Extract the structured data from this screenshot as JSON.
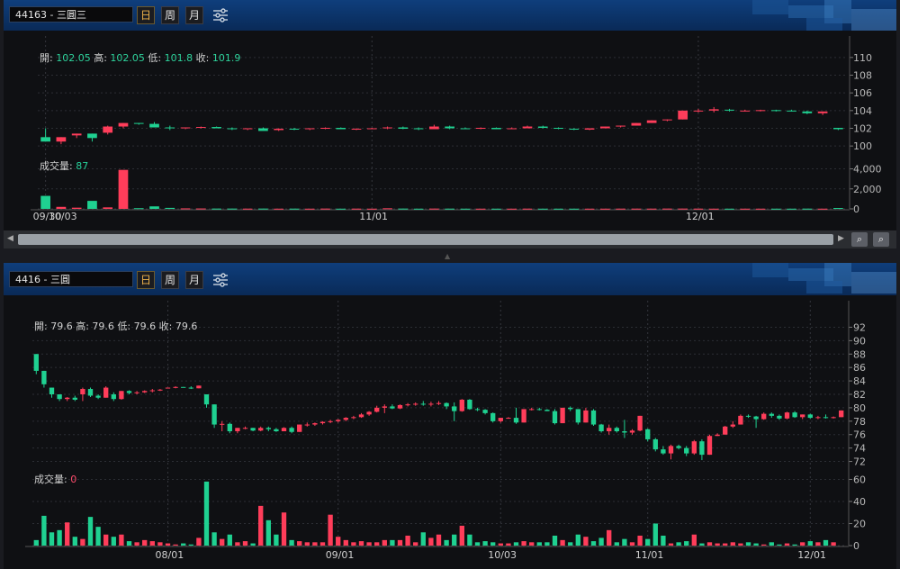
{
  "panels": [
    {
      "symbol": "44163 - 三圓三",
      "periods": [
        "日",
        "周",
        "月"
      ],
      "active_period": "日",
      "ohlc": {
        "open_label": "開:",
        "open": "102.05",
        "high_label": "高:",
        "high": "102.05",
        "low_label": "低:",
        "low": "101.8",
        "close_label": "收:",
        "close": "101.9"
      },
      "volume": {
        "label": "成交量:",
        "value": "87",
        "color": "#26d09a"
      },
      "price_axis": {
        "min": 99,
        "max": 111,
        "ticks": [
          "110",
          "108",
          "106",
          "104",
          "102",
          "100"
        ]
      },
      "volume_axis": {
        "max": 4500,
        "ticks": [
          "4,000",
          "2,000",
          "0"
        ]
      },
      "date_labels": [
        {
          "label": "09/30",
          "i": 0
        },
        {
          "label": "10/03",
          "i": 1
        },
        {
          "label": "11/01",
          "i": 21
        },
        {
          "label": "12/01",
          "i": 42
        }
      ],
      "gridlines_i": [
        0,
        21,
        42
      ],
      "bars": [
        [
          101,
          102,
          100.5,
          100.5,
          1300
        ],
        [
          100.5,
          101,
          100.2,
          101,
          200
        ],
        [
          101.2,
          101.4,
          100.9,
          101.4,
          120
        ],
        [
          101.4,
          101.4,
          100.5,
          100.9,
          800
        ],
        [
          101.5,
          102.3,
          101.3,
          102.2,
          150
        ],
        [
          102.2,
          102.6,
          102,
          102.6,
          3900
        ],
        [
          102.6,
          102.6,
          102.4,
          102.5,
          70
        ],
        [
          102.5,
          102.7,
          102.1,
          102.1,
          250
        ],
        [
          102.1,
          102.3,
          101.8,
          102,
          100
        ],
        [
          102,
          102.1,
          101.9,
          102.1,
          50
        ],
        [
          102.1,
          102.2,
          102,
          102.15,
          40
        ],
        [
          102.15,
          102.2,
          102,
          102,
          30
        ],
        [
          102,
          102.1,
          101.8,
          101.9,
          30
        ],
        [
          101.9,
          102,
          101.8,
          102,
          25
        ],
        [
          102,
          102.1,
          101.8,
          101.7,
          30
        ],
        [
          101.8,
          102,
          101.7,
          101.95,
          20
        ],
        [
          101.95,
          102.05,
          101.8,
          101.85,
          25
        ],
        [
          101.9,
          102,
          101.8,
          102,
          20
        ],
        [
          102,
          102.1,
          101.9,
          102.05,
          30
        ],
        [
          102.05,
          102.1,
          101.9,
          101.9,
          20
        ],
        [
          101.9,
          102,
          101.8,
          101.95,
          25
        ],
        [
          101.95,
          102.05,
          101.9,
          102,
          20
        ],
        [
          102,
          102.2,
          101.9,
          102.1,
          60
        ],
        [
          102.1,
          102.2,
          101.9,
          101.95,
          30
        ],
        [
          102,
          102.1,
          101.8,
          101.9,
          20
        ],
        [
          101.9,
          102.4,
          101.9,
          102.2,
          30
        ],
        [
          102.2,
          102.3,
          101.9,
          102,
          25
        ],
        [
          102,
          102.1,
          101.9,
          101.95,
          20
        ],
        [
          101.95,
          102.1,
          101.9,
          102.05,
          20
        ],
        [
          102.05,
          102.1,
          101.9,
          101.9,
          20
        ],
        [
          101.9,
          102.1,
          101.9,
          102,
          20
        ],
        [
          102,
          102.3,
          102,
          102.2,
          25
        ],
        [
          102.2,
          102.3,
          102,
          102.05,
          20
        ],
        [
          102.05,
          102.1,
          101.9,
          101.95,
          20
        ],
        [
          101.95,
          102,
          101.8,
          101.85,
          20
        ],
        [
          101.85,
          102,
          101.8,
          102,
          20
        ],
        [
          102,
          102.2,
          102,
          102.2,
          20
        ],
        [
          102.2,
          102.3,
          102.1,
          102.3,
          25
        ],
        [
          102.3,
          102.6,
          102.3,
          102.6,
          25
        ],
        [
          102.6,
          102.9,
          102.6,
          102.9,
          25
        ],
        [
          102.9,
          103,
          102.8,
          103,
          30
        ],
        [
          103,
          104,
          103,
          104,
          30
        ],
        [
          104,
          104.2,
          103.8,
          104,
          25
        ],
        [
          104,
          104.4,
          103.8,
          104.15,
          20
        ],
        [
          104.1,
          104.2,
          103.9,
          104,
          20
        ],
        [
          104,
          104.1,
          103.9,
          104,
          20
        ],
        [
          104,
          104.1,
          103.9,
          104.05,
          20
        ],
        [
          104.05,
          104.1,
          103.9,
          104,
          20
        ],
        [
          104,
          104.1,
          103.9,
          103.9,
          20
        ],
        [
          103.9,
          104,
          103.6,
          103.7,
          25
        ],
        [
          103.7,
          103.9,
          103.5,
          103.9,
          20
        ],
        [
          102.05,
          102.05,
          101.8,
          101.9,
          87
        ]
      ]
    },
    {
      "symbol": "4416 - 三圓",
      "periods": [
        "日",
        "周",
        "月"
      ],
      "active_period": "日",
      "ohlc": {
        "open_label": "開:",
        "open": "79.6",
        "high_label": "高:",
        "high": "79.6",
        "low_label": "低:",
        "low": "79.6",
        "close_label": "收:",
        "close": "79.6"
      },
      "volume": {
        "label": "成交量:",
        "value": "0",
        "color": "#ff4d6d"
      },
      "price_axis": {
        "min": 71,
        "max": 93,
        "ticks": [
          "92",
          "90",
          "88",
          "86",
          "84",
          "82",
          "80",
          "78",
          "76",
          "74",
          "72"
        ]
      },
      "volume_axis": {
        "max": 62,
        "ticks": [
          "60",
          "40",
          "20",
          "0"
        ]
      },
      "date_labels": [
        {
          "label": "08/01",
          "i": 17
        },
        {
          "label": "09/01",
          "i": 39
        },
        {
          "label": "10/03",
          "i": 60
        },
        {
          "label": "11/01",
          "i": 79
        },
        {
          "label": "12/01",
          "i": 100
        }
      ],
      "gridlines_i": [
        17,
        39,
        60,
        79,
        100
      ],
      "bars": [
        [
          88,
          88,
          85,
          85.5,
          5
        ],
        [
          85.5,
          85.5,
          83,
          83.5,
          27
        ],
        [
          83,
          83,
          81.5,
          82,
          12
        ],
        [
          82,
          82,
          81,
          81.3,
          14
        ],
        [
          81.3,
          81.6,
          81,
          81.5,
          21
        ],
        [
          81.5,
          81.8,
          81,
          81.2,
          8
        ],
        [
          82,
          83,
          81,
          82.8,
          6
        ],
        [
          82.8,
          83,
          81.6,
          81.8,
          26
        ],
        [
          81.8,
          82,
          81.3,
          81.5,
          17
        ],
        [
          81.5,
          83.2,
          81.5,
          83,
          10
        ],
        [
          82,
          82.3,
          81,
          81.3,
          8
        ],
        [
          81.3,
          82.5,
          81.2,
          82.5,
          10
        ],
        [
          82.5,
          82.6,
          82,
          82.2,
          4
        ],
        [
          82.2,
          82.5,
          82,
          82.3,
          3
        ],
        [
          82.3,
          82.6,
          82.2,
          82.5,
          5
        ],
        [
          82.5,
          82.8,
          82.3,
          82.6,
          4
        ],
        [
          82.6,
          82.8,
          82.5,
          82.7,
          3
        ],
        [
          83,
          83,
          82.9,
          83,
          2
        ],
        [
          83,
          83.2,
          82.9,
          83.1,
          1
        ],
        [
          83.1,
          83.1,
          83,
          83,
          2
        ],
        [
          83,
          83.2,
          82.8,
          82.9,
          1
        ],
        [
          82.9,
          83.3,
          82.9,
          83.3,
          7
        ],
        [
          82,
          82,
          80,
          80.5,
          58
        ],
        [
          80.5,
          80.5,
          77,
          77.5,
          12
        ],
        [
          77.5,
          78,
          76.5,
          77.6,
          6
        ],
        [
          77.6,
          77.8,
          76.2,
          76.5,
          10
        ],
        [
          76.5,
          77,
          76.2,
          77,
          3
        ],
        [
          77,
          77.2,
          76.8,
          77,
          4
        ],
        [
          77,
          77,
          76.5,
          76.6,
          2
        ],
        [
          76.6,
          77.2,
          76.5,
          77,
          36
        ],
        [
          77,
          77.2,
          76.5,
          76.8,
          23
        ],
        [
          76.8,
          77,
          76.4,
          76.5,
          10
        ],
        [
          76.5,
          77.1,
          76.5,
          77,
          30
        ],
        [
          77,
          77.2,
          76.2,
          76.4,
          5
        ],
        [
          76.4,
          77.5,
          76.4,
          77.5,
          4
        ],
        [
          77.5,
          77.8,
          77.2,
          77.5,
          3
        ],
        [
          77.5,
          77.8,
          77.3,
          77.7,
          3
        ],
        [
          77.7,
          78,
          77.5,
          77.9,
          3
        ],
        [
          77.9,
          78.2,
          77.7,
          78,
          28
        ],
        [
          78,
          78.3,
          77.8,
          78.2,
          8
        ],
        [
          78.2,
          78.6,
          78,
          78.5,
          5
        ],
        [
          78.5,
          78.8,
          78.3,
          78.6,
          3
        ],
        [
          78.6,
          79.2,
          78.5,
          79,
          4
        ],
        [
          79,
          79.5,
          78.8,
          79.4,
          3
        ],
        [
          79.4,
          80.3,
          79.3,
          80,
          3
        ],
        [
          80,
          80.5,
          79.2,
          80.2,
          5
        ],
        [
          80.2,
          80.5,
          79.8,
          79.9,
          5
        ],
        [
          79.9,
          80.5,
          79.8,
          80.4,
          5
        ],
        [
          80.4,
          80.7,
          80.2,
          80.5,
          9
        ],
        [
          80.5,
          80.8,
          80.3,
          80.6,
          3
        ],
        [
          80.6,
          81,
          80.3,
          80.5,
          12
        ],
        [
          80.5,
          80.9,
          80.2,
          80.6,
          7
        ],
        [
          80.6,
          81,
          80.4,
          80.7,
          10
        ],
        [
          80.7,
          80.8,
          79.8,
          80.2,
          5
        ],
        [
          80.2,
          80.8,
          78,
          79.5,
          10
        ],
        [
          79.5,
          81.3,
          79.4,
          81.2,
          18
        ],
        [
          81.2,
          81.3,
          79.7,
          79.8,
          10
        ],
        [
          79.8,
          80,
          79.5,
          79.7,
          3
        ],
        [
          79.7,
          79.8,
          79,
          79.2,
          4
        ],
        [
          79.2,
          79.3,
          77.8,
          78,
          3
        ],
        [
          78,
          78.5,
          77.8,
          78.5,
          2
        ],
        [
          78.5,
          78.6,
          78.4,
          78.5,
          2
        ],
        [
          78.5,
          80,
          77.6,
          77.8,
          3
        ],
        [
          77.8,
          79.8,
          77.8,
          79.8,
          4
        ],
        [
          79.8,
          80,
          79.6,
          79.8,
          3
        ],
        [
          79.8,
          80,
          79.6,
          79.7,
          3
        ],
        [
          79.7,
          79.8,
          79.5,
          79.5,
          3
        ],
        [
          79.5,
          79.8,
          77.5,
          77.7,
          9
        ],
        [
          77.7,
          80,
          77.7,
          80,
          5
        ],
        [
          80,
          80.2,
          79.5,
          79.8,
          3
        ],
        [
          79.8,
          79.8,
          77.5,
          77.8,
          10
        ],
        [
          77.8,
          80,
          77.8,
          79.6,
          8
        ],
        [
          79.6,
          79.8,
          77.3,
          77.5,
          4
        ],
        [
          77.5,
          77.6,
          76.3,
          76.5,
          7
        ],
        [
          76.5,
          77.5,
          76,
          77,
          14
        ],
        [
          77,
          77.2,
          76.3,
          76.5,
          3
        ],
        [
          76.5,
          78.2,
          75.5,
          76.3,
          6
        ],
        [
          76.3,
          76.8,
          76,
          76.6,
          3
        ],
        [
          76.6,
          78.8,
          76.5,
          78.8,
          9
        ],
        [
          76.8,
          76.9,
          75,
          75.3,
          6
        ],
        [
          75.3,
          75.5,
          73.5,
          73.8,
          20
        ],
        [
          73.8,
          74.3,
          73,
          73.2,
          9
        ],
        [
          73.2,
          74.5,
          72.3,
          74.3,
          2
        ],
        [
          74.3,
          74.5,
          73.8,
          74,
          3
        ],
        [
          74,
          74.3,
          72.8,
          73.2,
          4
        ],
        [
          73.2,
          75.2,
          73,
          75,
          10
        ],
        [
          75,
          75.3,
          72.2,
          73,
          2
        ],
        [
          73,
          76,
          73,
          75.8,
          3
        ],
        [
          75.8,
          76.2,
          75.8,
          76,
          2
        ],
        [
          76,
          77.3,
          76,
          77.2,
          2
        ],
        [
          77.2,
          78,
          77,
          77.5,
          3
        ],
        [
          77.5,
          79,
          77.5,
          78.8,
          2
        ],
        [
          78.8,
          79,
          78.5,
          78.7,
          3
        ],
        [
          78.7,
          78.8,
          77,
          78.3,
          2
        ],
        [
          78.3,
          79.3,
          78.2,
          79.1,
          1
        ],
        [
          79.1,
          79.3,
          78.5,
          78.8,
          3
        ],
        [
          78.8,
          79,
          78.2,
          78.4,
          1
        ],
        [
          78.4,
          79.4,
          78.3,
          79.3,
          2
        ],
        [
          79.3,
          79.5,
          78.5,
          78.6,
          1
        ],
        [
          78.6,
          79,
          78.3,
          79,
          3
        ],
        [
          79,
          79.1,
          78.4,
          78.5,
          4
        ],
        [
          78.5,
          78.8,
          78.3,
          78.6,
          3
        ],
        [
          78.6,
          79,
          78.4,
          78.5,
          5
        ],
        [
          78.5,
          78.7,
          78.4,
          78.6,
          3
        ],
        [
          78.6,
          79.6,
          78.6,
          79.6,
          0
        ]
      ]
    }
  ]
}
